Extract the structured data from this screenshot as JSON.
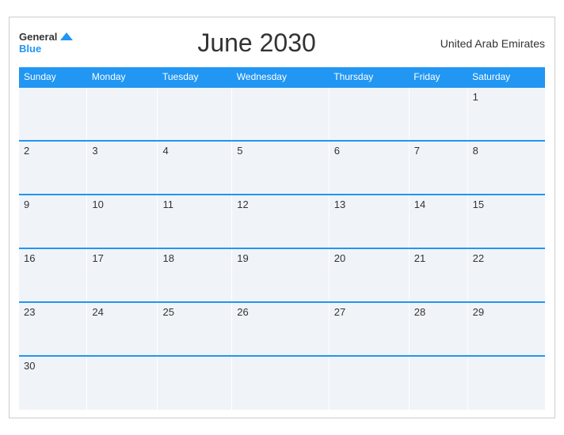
{
  "header": {
    "logo_general": "General",
    "logo_blue": "Blue",
    "month_title": "June 2030",
    "region": "United Arab Emirates"
  },
  "weekdays": [
    "Sunday",
    "Monday",
    "Tuesday",
    "Wednesday",
    "Thursday",
    "Friday",
    "Saturday"
  ],
  "weeks": [
    [
      "",
      "",
      "",
      "",
      "",
      "",
      "1"
    ],
    [
      "2",
      "3",
      "4",
      "5",
      "6",
      "7",
      "8"
    ],
    [
      "9",
      "10",
      "11",
      "12",
      "13",
      "14",
      "15"
    ],
    [
      "16",
      "17",
      "18",
      "19",
      "20",
      "21",
      "22"
    ],
    [
      "23",
      "24",
      "25",
      "26",
      "27",
      "28",
      "29"
    ],
    [
      "30",
      "",
      "",
      "",
      "",
      "",
      ""
    ]
  ]
}
